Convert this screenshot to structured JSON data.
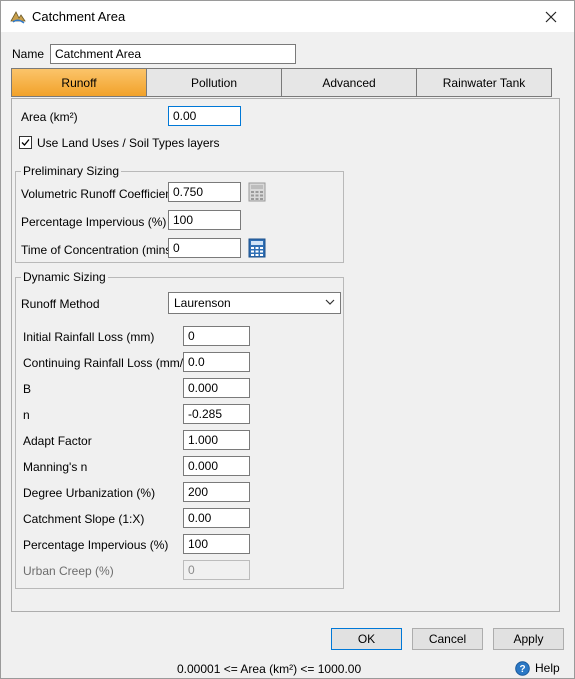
{
  "window": {
    "title": "Catchment Area"
  },
  "name_field": {
    "label": "Name",
    "value": "Catchment Area"
  },
  "tabs": [
    {
      "label": "Runoff",
      "active": true
    },
    {
      "label": "Pollution"
    },
    {
      "label": "Advanced"
    },
    {
      "label": "Rainwater Tank"
    }
  ],
  "area": {
    "label": "Area (km²)",
    "value": "0.00"
  },
  "use_layers": {
    "label": "Use Land Uses / Soil Types layers",
    "checked": true
  },
  "preliminary": {
    "title": "Preliminary Sizing",
    "fields": [
      {
        "label": "Volumetric Runoff Coefficient",
        "value": "0.750"
      },
      {
        "label": "Percentage Impervious (%)",
        "value": "100"
      },
      {
        "label": "Time of Concentration (mins)",
        "value": "0"
      }
    ]
  },
  "dynamic": {
    "title": "Dynamic Sizing",
    "method_label": "Runoff Method",
    "method_value": "Laurenson",
    "fields": [
      {
        "label": "Initial Rainfall Loss (mm)",
        "value": "0"
      },
      {
        "label": "Continuing Rainfall Loss (mm/hr)",
        "value": "0.0"
      },
      {
        "label": "B",
        "value": "0.000"
      },
      {
        "label": "n",
        "value": "-0.285"
      },
      {
        "label": "Adapt Factor",
        "value": "1.000"
      },
      {
        "label": "Manning's n",
        "value": "0.000"
      },
      {
        "label": "Degree Urbanization (%)",
        "value": "200"
      },
      {
        "label": "Catchment Slope (1:X)",
        "value": "0.00"
      },
      {
        "label": "Percentage Impervious (%)",
        "value": "100"
      },
      {
        "label": "Urban Creep (%)",
        "value": "0"
      }
    ]
  },
  "buttons": {
    "ok": "OK",
    "cancel": "Cancel",
    "apply": "Apply"
  },
  "status": {
    "range": "0.00001 <= Area (km²) <= 1000.00",
    "help": "Help"
  },
  "colors": {
    "active_tab": "#f2a22a",
    "focus_border": "#0078d7"
  }
}
